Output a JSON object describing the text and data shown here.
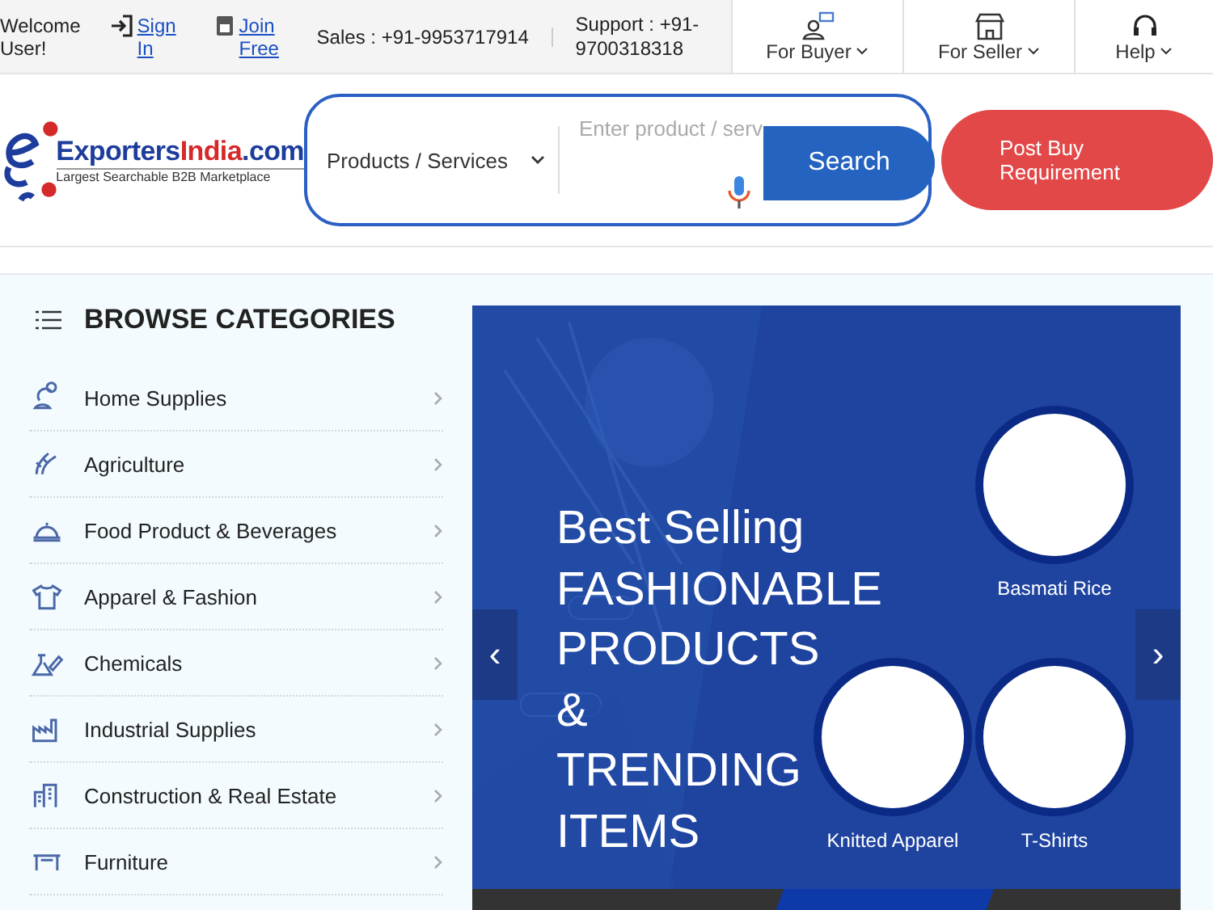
{
  "top_bar": {
    "welcome": "Welcome User!",
    "sign_in": "Sign In",
    "join_free": "Join Free",
    "sales": "Sales : +91-9953717914",
    "support": "Support : +91-9700318318",
    "menus": [
      {
        "label": "For Buyer"
      },
      {
        "label": "For Seller"
      },
      {
        "label": "Help"
      }
    ]
  },
  "header": {
    "logo": {
      "part_1": "Exporters",
      "part_2": "India",
      "part_3": ".com",
      "tagline": "Largest Searchable B2B Marketplace"
    },
    "search": {
      "category": "Products / Services",
      "placeholder": "Enter product / serv",
      "button": "Search"
    },
    "post_button": "Post Buy Requirement"
  },
  "sidebar": {
    "title": "BROWSE CATEGORIES",
    "items": [
      {
        "label": "Home Supplies"
      },
      {
        "label": "Agriculture"
      },
      {
        "label": "Food Product & Beverages"
      },
      {
        "label": "Apparel & Fashion"
      },
      {
        "label": "Chemicals"
      },
      {
        "label": "Industrial Supplies"
      },
      {
        "label": "Construction & Real Estate"
      },
      {
        "label": "Furniture"
      }
    ]
  },
  "banner": {
    "headline": [
      "Best Selling",
      "FASHIONABLE",
      "PRODUCTS",
      "&",
      "TRENDING",
      "ITEMS"
    ],
    "products": [
      {
        "label": "Basmati Rice"
      },
      {
        "label": "Knitted Apparel"
      },
      {
        "label": "T-Shirts"
      }
    ],
    "prev": "‹",
    "next": "›"
  }
}
